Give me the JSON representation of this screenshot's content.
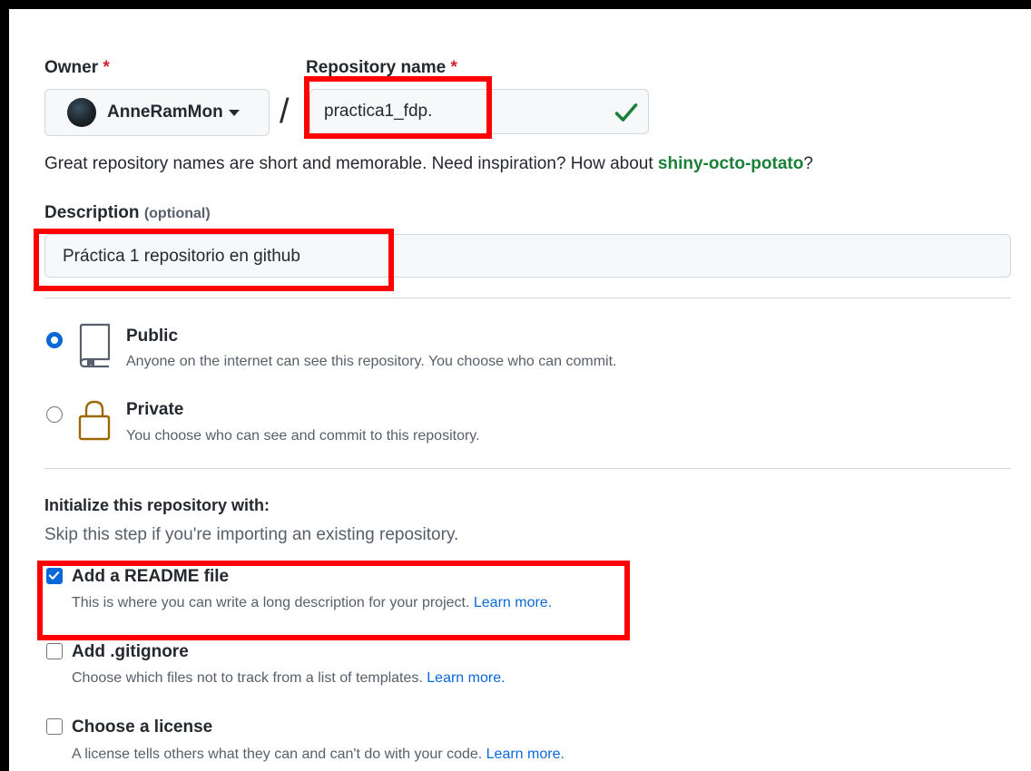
{
  "owner": {
    "label": "Owner",
    "required_mark": "*",
    "value": "AnneRamMon"
  },
  "separator": "/",
  "repo_name": {
    "label": "Repository name",
    "required_mark": "*",
    "value": "practica1_fdp."
  },
  "name_hint": {
    "text": "Great repository names are short and memorable. Need inspiration? How about ",
    "suggestion": "shiny-octo-potato",
    "end": "?"
  },
  "description": {
    "label": "Description",
    "optional": "(optional)",
    "value": "Práctica 1 repositorio en github"
  },
  "visibility": [
    {
      "title": "Public",
      "desc": "Anyone on the internet can see this repository. You choose who can commit.",
      "selected": true
    },
    {
      "title": "Private",
      "desc": "You choose who can see and commit to this repository.",
      "selected": false
    }
  ],
  "init": {
    "title": "Initialize this repository with:",
    "subtitle": "Skip this step if you're importing an existing repository.",
    "options": [
      {
        "title": "Add a README file",
        "desc": "This is where you can write a long description for your project. ",
        "link": "Learn more.",
        "checked": true
      },
      {
        "title": "Add .gitignore",
        "desc": "Choose which files not to track from a list of templates. ",
        "link": "Learn more.",
        "checked": false
      },
      {
        "title": "Choose a license",
        "desc": "A license tells others what they can and can't do with your code. ",
        "link": "Learn more.",
        "checked": false
      }
    ]
  },
  "colors": {
    "accent": "#0969da",
    "success": "#1a7f37",
    "required": "#cf222e",
    "highlight": "#ff0000",
    "lock": "#9a6700"
  }
}
